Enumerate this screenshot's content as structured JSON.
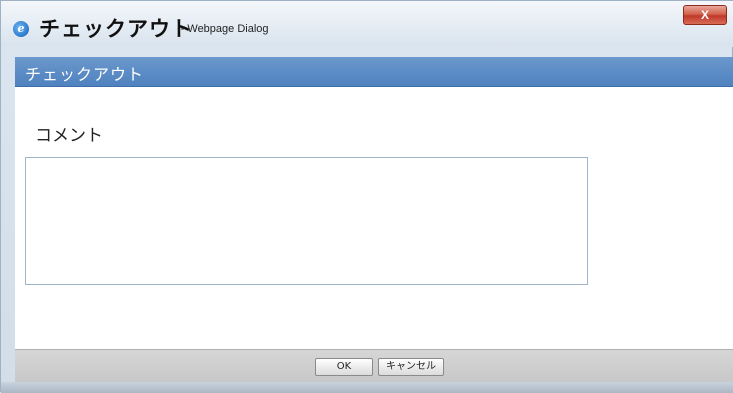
{
  "window": {
    "title_main": "チェックアウト",
    "title_sub": "-- Webpage Dialog",
    "close_label": "X",
    "browser_icon": "ie-icon"
  },
  "header": {
    "title": "チェックアウト"
  },
  "form": {
    "comment_label": "コメント",
    "comment_value": ""
  },
  "footer": {
    "ok_label": "OK",
    "cancel_label": "キャンセル"
  },
  "colors": {
    "header_bar": "#4f82bf",
    "close_button": "#c0392b",
    "footer_bg": "#c8c8c8"
  }
}
